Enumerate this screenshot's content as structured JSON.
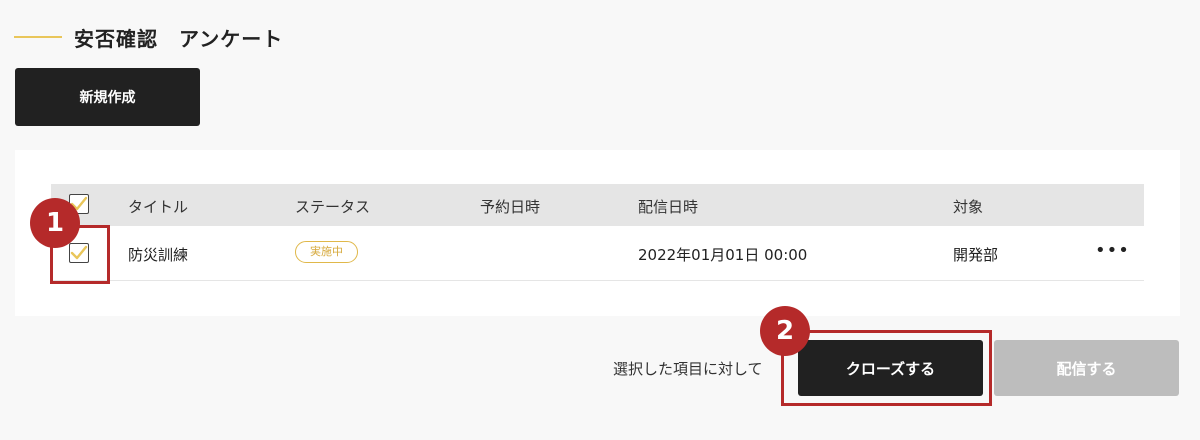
{
  "page": {
    "title": "安否確認　アンケート"
  },
  "toolbar": {
    "new_label": "新規作成"
  },
  "table": {
    "headers": {
      "title": "タイトル",
      "status": "ステータス",
      "scheduled": "予約日時",
      "delivered": "配信日時",
      "target": "対象"
    },
    "rows": [
      {
        "title": "防災訓練",
        "status": "実施中",
        "scheduled": "",
        "delivered": "2022年01月01日 00:00",
        "target": "開発部",
        "more": "•••",
        "checked": true
      }
    ]
  },
  "footer": {
    "selection_label": "選択した項目に対して",
    "close_label": "クローズする",
    "send_label": "配信する"
  },
  "markers": {
    "first": "1",
    "second": "2"
  },
  "colors": {
    "accent": "#e9c65a",
    "highlight": "#b52a2a",
    "dark_button": "#212121",
    "disabled_button": "#bdbdbd"
  },
  "icons": {
    "checkbox_check": "check-icon",
    "more": "more-icon"
  }
}
